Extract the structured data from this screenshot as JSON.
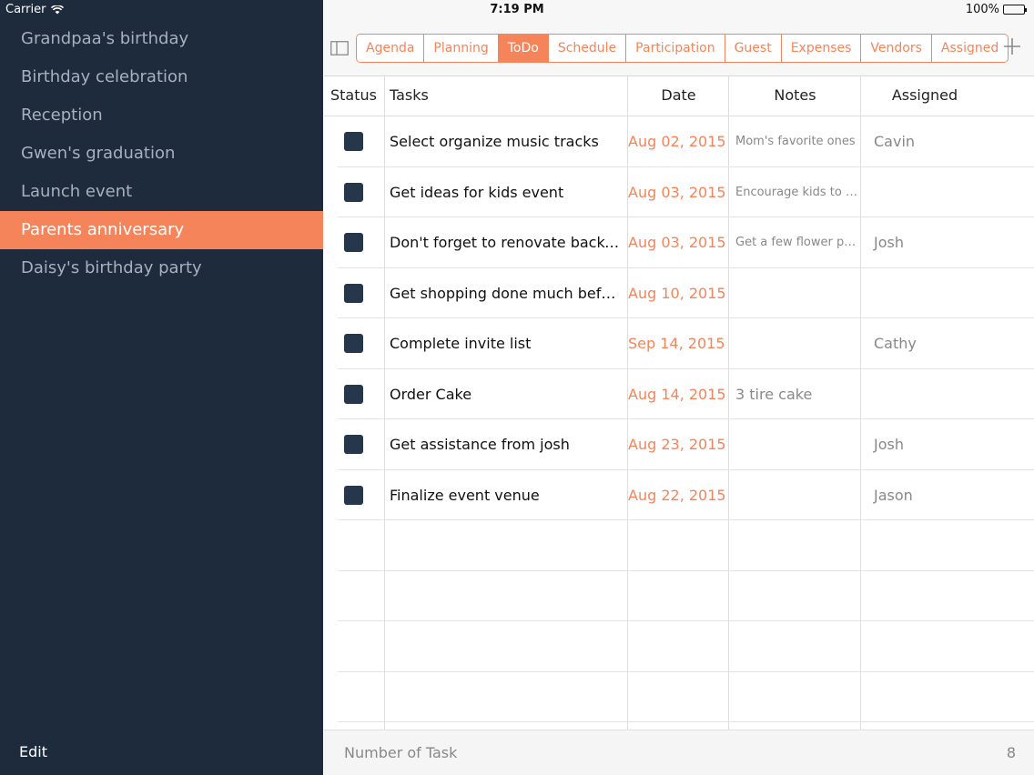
{
  "status_bar": {
    "carrier": "Carrier",
    "time": "7:19 PM",
    "battery": "100%",
    "battery_level": 1.0
  },
  "sidebar": {
    "items": [
      {
        "label": "Grandpaa's birthday",
        "active": false
      },
      {
        "label": "Birthday celebration",
        "active": false
      },
      {
        "label": "Reception",
        "active": false
      },
      {
        "label": "Gwen's graduation",
        "active": false
      },
      {
        "label": "Launch event",
        "active": false
      },
      {
        "label": "Parents anniversary",
        "active": true
      },
      {
        "label": "Daisy's birthday party",
        "active": false
      }
    ],
    "edit_label": "Edit"
  },
  "toolbar": {
    "tabs": [
      {
        "label": "Agenda",
        "active": false
      },
      {
        "label": "Planning",
        "active": false
      },
      {
        "label": "ToDo",
        "active": true
      },
      {
        "label": "Schedule",
        "active": false
      },
      {
        "label": "Participation",
        "active": false
      },
      {
        "label": "Guest",
        "active": false
      },
      {
        "label": "Expenses",
        "active": false
      },
      {
        "label": "Vendors",
        "active": false
      },
      {
        "label": "Assigned",
        "active": false
      }
    ],
    "sidebar_toggle_icon": "sidebar-toggle-icon",
    "add_icon": "plus-icon"
  },
  "table": {
    "headers": {
      "status": "Status",
      "tasks": "Tasks",
      "date": "Date",
      "notes": "Notes",
      "assigned": "Assigned"
    },
    "rows": [
      {
        "task": "Select organize music tracks",
        "date": "Aug 02, 2015",
        "notes": "Mom's favorite ones",
        "assigned": "Cavin"
      },
      {
        "task": "Get ideas for kids event",
        "date": "Aug 03, 2015",
        "notes": "Encourage kids to p...",
        "assigned": ""
      },
      {
        "task": "Don't forget to renovate backy...",
        "date": "Aug 03, 2015",
        "notes": "Get a few flower pla...",
        "assigned": "Josh"
      },
      {
        "task": "Get shopping done much befo...",
        "date": "Aug 10, 2015",
        "notes": "",
        "assigned": ""
      },
      {
        "task": "Complete invite list",
        "date": "Sep 14, 2015",
        "notes": "",
        "assigned": "Cathy"
      },
      {
        "task": "Order Cake",
        "date": "Aug 14, 2015",
        "notes": "3 tire cake",
        "assigned": ""
      },
      {
        "task": "Get assistance from josh",
        "date": "Aug 23, 2015",
        "notes": "",
        "assigned": "Josh"
      },
      {
        "task": "Finalize event venue",
        "date": "Aug 22, 2015",
        "notes": "",
        "assigned": "Jason"
      }
    ]
  },
  "footer": {
    "label": "Number of Task",
    "count": "8"
  },
  "colors": {
    "accent": "#f5845a",
    "sidebar_bg": "#1e2b3c",
    "checkbox": "#26374b"
  }
}
